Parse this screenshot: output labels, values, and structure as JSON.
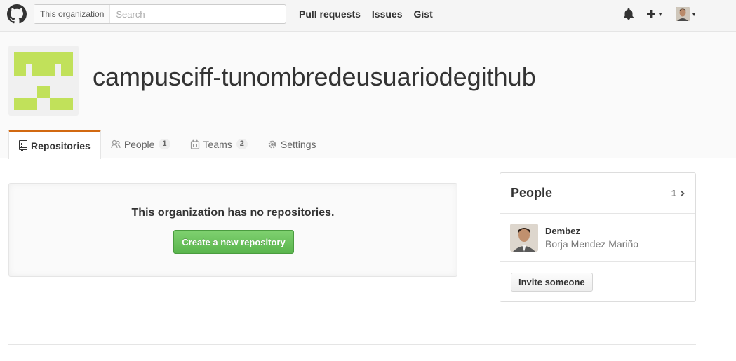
{
  "header": {
    "search_scope": "This organization",
    "search_placeholder": "Search",
    "nav": [
      "Pull requests",
      "Issues",
      "Gist"
    ],
    "logo_icon": "github-octocat-icon",
    "notifications_icon": "bell-icon",
    "create_icon": "plus-icon",
    "avatar_icon": "user-avatar"
  },
  "org": {
    "name": "campusciff-tunombredeusuariodegithub",
    "avatar_color": "#c1e15a"
  },
  "tabs": [
    {
      "label": "Repositories",
      "icon": "repo-icon",
      "selected": true
    },
    {
      "label": "People",
      "icon": "people-icon",
      "count": "1"
    },
    {
      "label": "Teams",
      "icon": "teams-icon",
      "count": "2"
    },
    {
      "label": "Settings",
      "icon": "gear-icon"
    }
  ],
  "blankslate": {
    "message": "This organization has no repositories.",
    "button_label": "Create a new repository"
  },
  "people_box": {
    "title": "People",
    "count": "1",
    "member": {
      "login": "Dembez",
      "name": "Borja Mendez Mariño"
    },
    "invite_label": "Invite someone"
  },
  "colors": {
    "accent_tab": "#d26911",
    "primary_button": "#5ab54d",
    "identicon": "#c1e15a"
  }
}
